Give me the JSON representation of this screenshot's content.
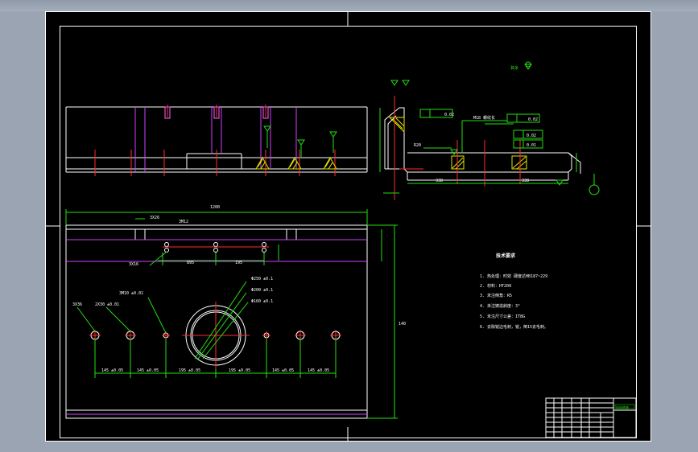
{
  "colors": {
    "background": "#9aa4b2",
    "sheet": "#000000",
    "outline": "#ffffff",
    "dimension": "#22e010",
    "centerline": "#ff2a2a",
    "hidden": "#d040ff",
    "section": "#e6e600"
  },
  "labels": {
    "roughness_note": "其余",
    "overall_length": "1200",
    "dim_3x26": "3X26",
    "dim_3m12": "3M12",
    "dim_3x16": "3X16",
    "dim_895": "895",
    "dim_195_top": "195",
    "dim_height": "140",
    "dim_3m10": "3M10 ±0.01",
    "dim_3x36": "3X36",
    "dim_2m10": "2X30 ±0.01",
    "dim_phi250": "Φ250 ±0.1",
    "dim_phi200": "Φ200 ±0.1",
    "dim_phi160": "Φ160 ±0.1",
    "dim_145_left": "145 ±0.05",
    "dim_145b": "145 ±0.05",
    "dim_195_left": "195 ±0.05",
    "dim_195_right": "195 ±0.05",
    "dim_145c": "145 ±0.05",
    "dim_145_right": "145 ±0.05",
    "dim_section_left": "338",
    "dim_section_right": "338",
    "tol_parallel": "0.02",
    "tol_perp": "0.02",
    "tol_flat": "0.02",
    "dim_r20": "R20",
    "dim_m18": "M18 螺纹长",
    "tol_side": "0.01"
  },
  "tech_req": {
    "title": "技术要求",
    "items": [
      "1. 热处理：时效 硬度达HB187~229",
      "2. 材料：HT200",
      "3. 未注倒角：R5",
      "4. 未注铸造斜度：3°",
      "5. 未注尺寸公差：IT8G",
      "6. 去除锐边毛刺，锐，倒15去毛刺。"
    ]
  },
  "title_block": {
    "name": "机床底座"
  }
}
